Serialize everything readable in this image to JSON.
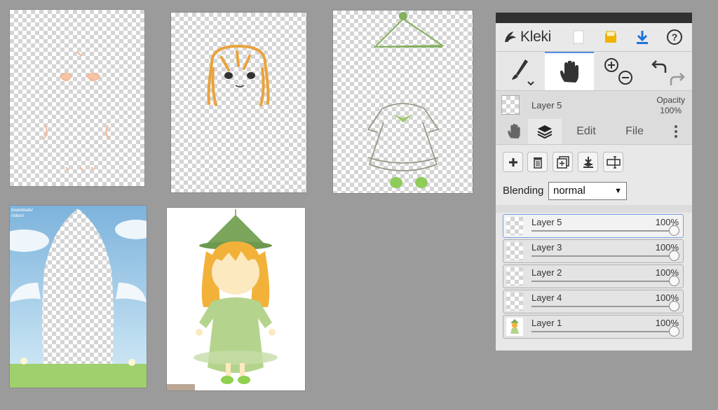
{
  "sky_watermark": [
    "bladeblade/",
    "ribbon/"
  ],
  "panel": {
    "logo_text": "Kleki",
    "menu_icons": [
      "new-image-icon",
      "open-folder-icon",
      "download-icon",
      "help-icon"
    ],
    "tools": [
      "brush-icon",
      "hand-icon",
      "zoom-in-icon",
      "zoom-out-icon",
      "undo-icon",
      "redo-icon"
    ],
    "current_layer": "Layer 5",
    "opacity_label": "Opacity",
    "opacity_value": "100%",
    "tabs": {
      "edit": "Edit",
      "file": "File"
    },
    "actions": [
      "add-layer-icon",
      "delete-layer-icon",
      "duplicate-layer-icon",
      "merge-down-icon",
      "rename-layer-icon"
    ],
    "blending_label": "Blending",
    "blending_value": "normal",
    "layers": [
      {
        "name": "Layer 5",
        "opacity": "100%",
        "active": true
      },
      {
        "name": "Layer 3",
        "opacity": "100%",
        "active": false
      },
      {
        "name": "Layer 2",
        "opacity": "100%",
        "active": false
      },
      {
        "name": "Layer 4",
        "opacity": "100%",
        "active": false
      },
      {
        "name": "Layer 1",
        "opacity": "100%",
        "active": false
      }
    ]
  },
  "colors": {
    "panel_bg": "#dcdcdc",
    "topbar": "#303030",
    "accent_blue": "#1e73d9",
    "folder_yellow": "#f0b400",
    "bg": "#9b9b9b"
  }
}
